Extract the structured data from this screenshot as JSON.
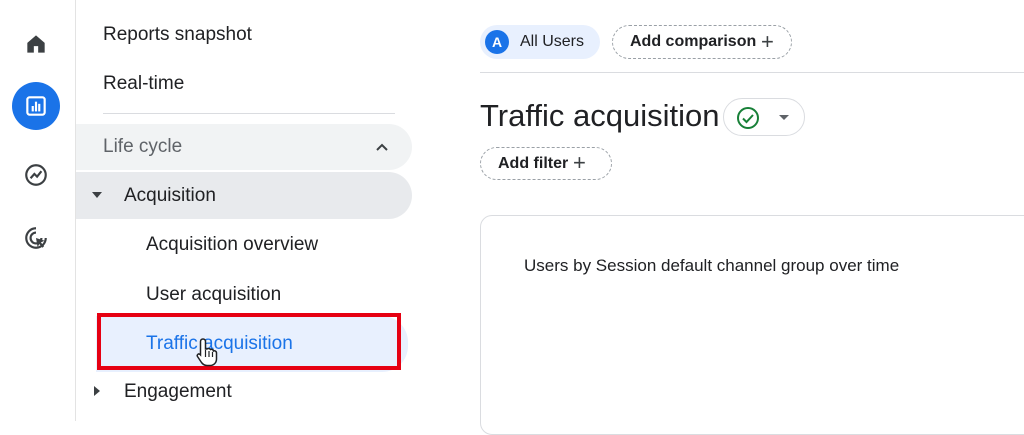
{
  "rail": {
    "items": [
      {
        "icon": "home-icon"
      },
      {
        "icon": "reports-icon",
        "active": true
      },
      {
        "icon": "explore-icon"
      },
      {
        "icon": "advertising-icon"
      }
    ]
  },
  "sidebar": {
    "reports_snapshot": "Reports snapshot",
    "realtime": "Real-time",
    "lifecycle": "Life cycle",
    "acquisition": "Acquisition",
    "acquisition_overview": "Acquisition overview",
    "user_acquisition": "User acquisition",
    "traffic_acquisition": "Traffic acquisition",
    "engagement": "Engagement"
  },
  "header": {
    "avatar_letter": "A",
    "all_users": "All Users",
    "add_comparison": "Add comparison"
  },
  "main": {
    "title": "Traffic acquisition",
    "add_filter": "Add filter",
    "card_title": "Users by Session default channel group over time"
  },
  "colors": {
    "accent": "#1a73e8",
    "highlight_border": "#e60012",
    "selected_bg": "#e8f0fe",
    "status_green": "#188038"
  }
}
